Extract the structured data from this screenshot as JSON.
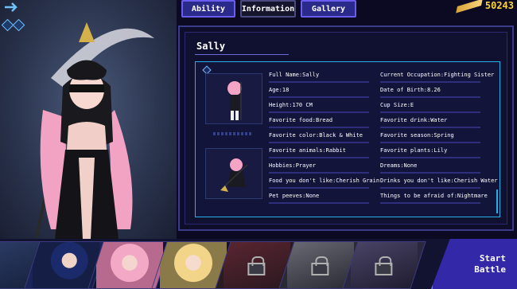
{
  "tabs": [
    {
      "label": "Ability"
    },
    {
      "label": "Information"
    },
    {
      "label": "Gallery"
    }
  ],
  "currency": {
    "value": "50243",
    "icon": "gold-bar-icon"
  },
  "character": {
    "name": "Sally",
    "fields": {
      "left": [
        "Full Name:Sally",
        "Age:18",
        "Height:170 CM",
        "Favorite food:Bread",
        "Favorite color:Black & White",
        "Favorite animals:Rabbit",
        "Hobbies:Prayer",
        "Food you don't like:Cherish Grain",
        "Pet peeves:None"
      ],
      "right": [
        "Current Occupation:Fighting Sister",
        "Date of Birth:8.26",
        "Cup Size:E",
        "Favorite drink:Water",
        "Favorite season:Spring",
        "Favorite plants:Lily",
        "Dreams:None",
        "Drinks you don't like:Cherish Water",
        "Things to be afraid of:Nightmare"
      ]
    }
  },
  "start_button": {
    "line1": "Start",
    "line2": "Battle"
  },
  "colors": {
    "accent": "#6a5cf0",
    "gold": "#ffd23a",
    "frame_border": "#29b0e8",
    "start": "#3328a8"
  }
}
